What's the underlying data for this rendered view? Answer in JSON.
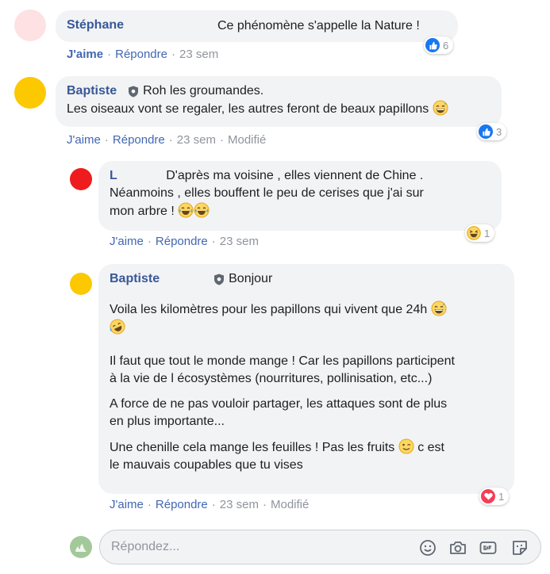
{
  "colors": {
    "link": "#4267b2",
    "author": "#385898",
    "bubble": "#f2f3f5",
    "muted": "#90949c",
    "avatar_stephane": "#fde1e3",
    "avatar_baptiste": "#fcc800",
    "avatar_l": "#ee1c1c",
    "avatar_me": "#a3c99a"
  },
  "comments": [
    {
      "author": "Stéphane",
      "text": "Ce phénomène s'appelle la Nature !",
      "actions": {
        "like": "J'aime",
        "reply": "Répondre",
        "time": "23 sem"
      },
      "reaction": {
        "icon": "thumbs-up-icon",
        "count": "6"
      }
    },
    {
      "author": "Baptiste",
      "badge": "Roh les groumandes.",
      "text": "Les oiseaux vont se regaler, les autres feront de beaux papillons",
      "actions": {
        "like": "J'aime",
        "reply": "Répondre",
        "time": "23 sem",
        "edited": "Modifié"
      },
      "reaction": {
        "icon": "thumbs-up-icon",
        "count": "3"
      }
    }
  ],
  "replies": [
    {
      "author": "L",
      "line1": "D'après ma voisine , elles viennent de Chine .",
      "line2": "Néanmoins , elles bouffent le peu de cerises que j'ai sur",
      "line3": "mon arbre !",
      "actions": {
        "like": "J'aime",
        "reply": "Répondre",
        "time": "23 sem"
      },
      "reaction": {
        "icon": "laughing-emoji-icon",
        "count": "1"
      }
    },
    {
      "author": "Baptiste",
      "badge": "Bonjour",
      "p1": "Voila les kilomètres pour les papillons qui vivent que 24h",
      "p2a": "Il faut que tout le monde mange ! Car les papillons participent",
      "p2b": "à la vie de l écosystèmes (nourritures, pollinisation, etc...)",
      "p3a": "A force de ne pas vouloir partager, les attaques sont de plus",
      "p3b": "en plus importante...",
      "p4a": "Une chenille cela mange les feuilles ! Pas les fruits",
      "p4b": "c est",
      "p4c": "le mauvais coupables que tu vises",
      "actions": {
        "like": "J'aime",
        "reply": "Répondre",
        "time": "23 sem",
        "edited": "Modifié"
      },
      "reaction": {
        "icon": "heart-icon",
        "count": "1"
      }
    }
  ],
  "reply_box": {
    "placeholder": "Répondez...",
    "icons": [
      "smiley-icon",
      "camera-icon",
      "gif-icon",
      "sticker-icon"
    ]
  }
}
